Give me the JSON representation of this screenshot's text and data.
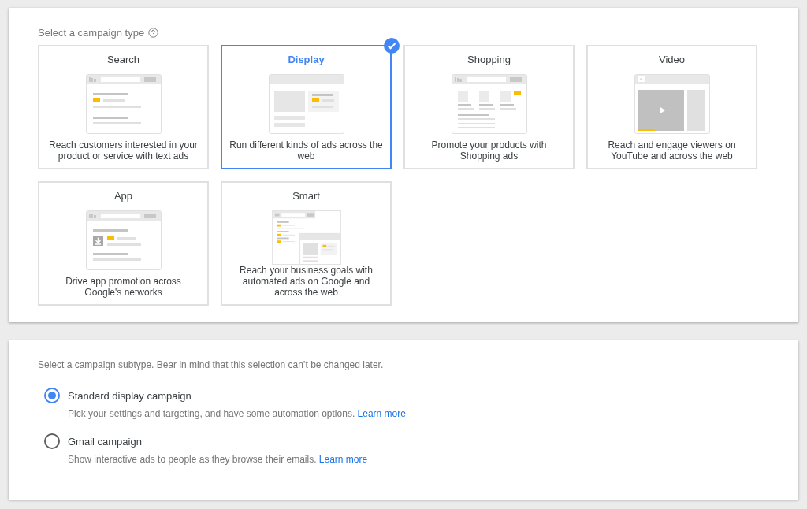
{
  "campaign_type": {
    "title": "Select a campaign type",
    "tiles": [
      {
        "kind": "search",
        "title": "Search",
        "description": "Reach customers interested in your product or service with text ads",
        "selected": false
      },
      {
        "kind": "display",
        "title": "Display",
        "description": "Run different kinds of ads across the web",
        "selected": true
      },
      {
        "kind": "shopping",
        "title": "Shopping",
        "description": "Promote your products with Shopping ads",
        "selected": false
      },
      {
        "kind": "video",
        "title": "Video",
        "description": "Reach and engage viewers on YouTube and across the web",
        "selected": false
      },
      {
        "kind": "app",
        "title": "App",
        "description": "Drive app promotion across Google's networks",
        "selected": false
      },
      {
        "kind": "smart",
        "title": "Smart",
        "description": "Reach your business goals with automated ads on Google and across the web",
        "selected": false
      }
    ]
  },
  "campaign_subtype": {
    "title": "Select a campaign subtype. Bear in mind that this selection can’t be changed later.",
    "options": [
      {
        "label": "Standard display campaign",
        "description": "Pick your settings and targeting, and have some automation options.",
        "link": "Learn more",
        "selected": true
      },
      {
        "label": "Gmail campaign",
        "description": "Show interactive ads to people as they browse their emails.",
        "link": "Learn more",
        "selected": false
      }
    ]
  }
}
